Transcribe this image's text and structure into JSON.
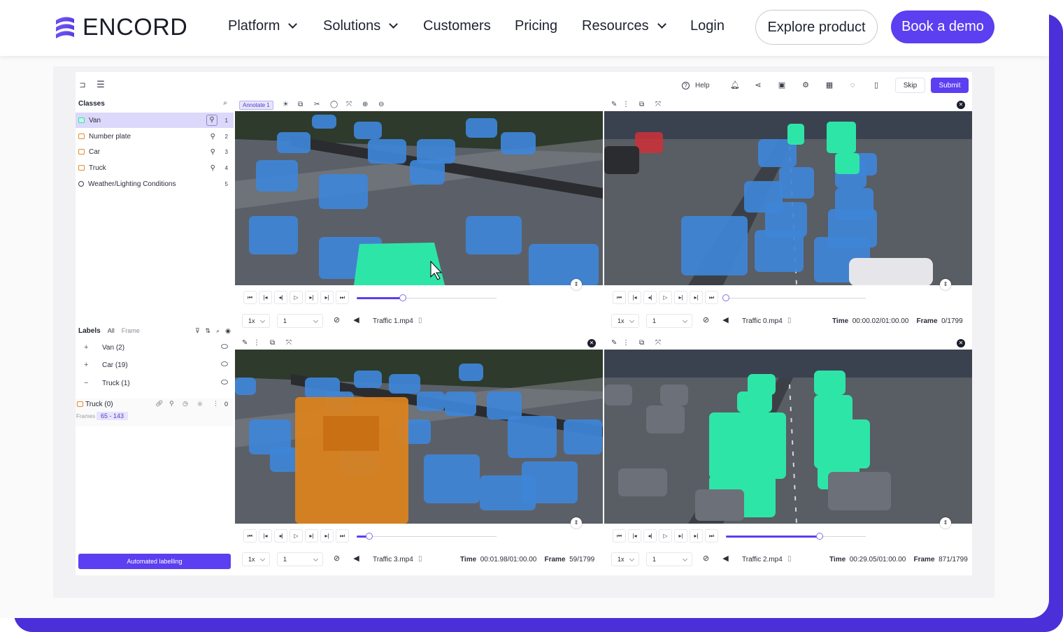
{
  "nav": {
    "logo_text": "ENCORD",
    "items": [
      {
        "label": "Platform",
        "dropdown": true
      },
      {
        "label": "Solutions",
        "dropdown": true
      },
      {
        "label": "Customers",
        "dropdown": false
      },
      {
        "label": "Pricing",
        "dropdown": false
      },
      {
        "label": "Resources",
        "dropdown": true
      },
      {
        "label": "Login",
        "dropdown": false
      }
    ],
    "explore_label": "Explore product",
    "demo_label": "Book a demo",
    "accent": "#5b3ff0"
  },
  "app": {
    "help_label": "Help",
    "skip_label": "Skip",
    "submit_label": "Submit",
    "classes_title": "Classes",
    "classes": [
      {
        "name": "Van",
        "num": "1",
        "color": "#2ee5a8",
        "active": true
      },
      {
        "name": "Number plate",
        "num": "2",
        "color": "#e58a2e",
        "active": false
      },
      {
        "name": "Car",
        "num": "3",
        "color": "#e58a2e",
        "active": false
      },
      {
        "name": "Truck",
        "num": "4",
        "color": "#e58a2e",
        "active": false
      },
      {
        "name": "Weather/Lighting Conditions",
        "num": "5",
        "color": "#3b3f4c",
        "active": false
      }
    ],
    "labels_title": "Labels",
    "labels_tab_all": "All",
    "labels_tab_frame": "Frame",
    "label_groups": [
      {
        "sign": "+",
        "text": "Van (2)"
      },
      {
        "sign": "+",
        "text": "Car (19)"
      },
      {
        "sign": "−",
        "text": "Truck (1)"
      }
    ],
    "truck_item": {
      "name": "Truck (0)",
      "count": "0",
      "frames_label": "Frames",
      "frames_range": "65  -  143"
    },
    "automated_label": "Automated labelling",
    "annotate_chip": "Annotate 1"
  },
  "videos": [
    {
      "file": "Traffic 1.mp4",
      "speed": "1x",
      "step": "1",
      "time": "",
      "frame": "",
      "progress": 0.33
    },
    {
      "file": "Traffic 0.mp4",
      "speed": "1x",
      "step": "1",
      "time_label": "Time",
      "time": "00:00.02/01:00.00",
      "frame_label": "Frame",
      "frame": "0/1799",
      "progress": 0.0
    },
    {
      "file": "Traffic 3.mp4",
      "speed": "1x",
      "step": "1",
      "time_label": "Time",
      "time": "00:01.98/01:00.00",
      "frame_label": "Frame",
      "frame": "59/1799",
      "progress": 0.09
    },
    {
      "file": "Traffic 2.mp4",
      "speed": "1x",
      "step": "1",
      "time_label": "Time",
      "time": "00:29.05/01:00.00",
      "frame_label": "Frame",
      "frame": "871/1799",
      "progress": 0.67
    }
  ]
}
